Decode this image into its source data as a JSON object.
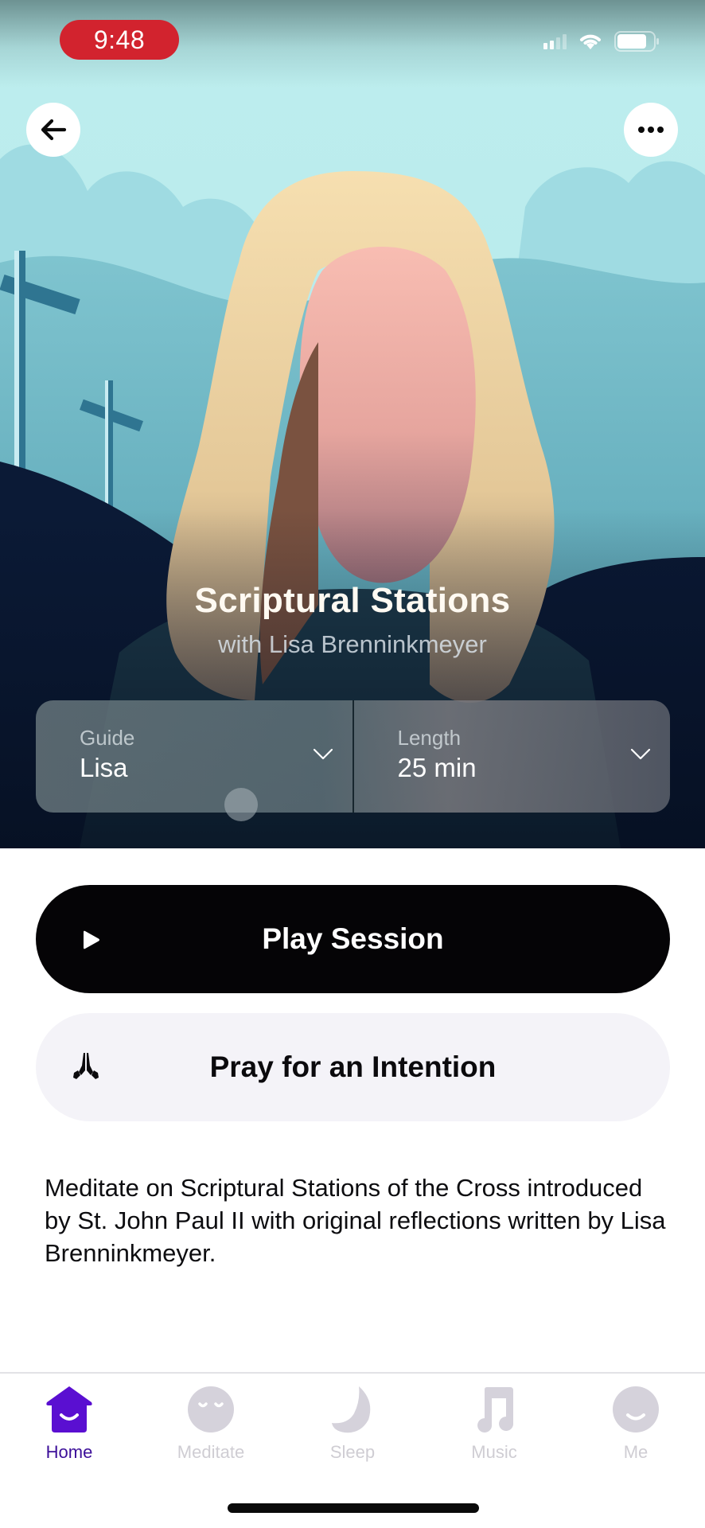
{
  "status_bar": {
    "time": "9:48",
    "icons": [
      "cellular-signal-icon",
      "wifi-icon",
      "battery-icon"
    ]
  },
  "header": {
    "back_icon": "arrow-left-icon",
    "more_icon": "ellipsis-horizontal-icon"
  },
  "session": {
    "title": "Scriptural Stations",
    "subtitle": "with Lisa Brenninkmeyer",
    "description": "Meditate on Scriptural Stations of the Cross introduced by St. John Paul II with original reflections written by Lisa Brenninkmeyer."
  },
  "selectors": [
    {
      "label": "Guide",
      "value": "Lisa",
      "icon": "chevron-down-icon"
    },
    {
      "label": "Length",
      "value": "25 min",
      "icon": "chevron-down-icon"
    }
  ],
  "actions": {
    "play": {
      "label": "Play Session",
      "icon": "play-icon"
    },
    "pray": {
      "label": "Pray for an Intention",
      "icon": "praying-hands-icon"
    }
  },
  "tabbar": {
    "active": "Home",
    "items": [
      {
        "label": "Home",
        "icon": "home-smile-icon"
      },
      {
        "label": "Meditate",
        "icon": "meditate-face-icon"
      },
      {
        "label": "Sleep",
        "icon": "moon-icon"
      },
      {
        "label": "Music",
        "icon": "music-note-icon"
      },
      {
        "label": "Me",
        "icon": "profile-smile-icon"
      }
    ]
  },
  "colors": {
    "accent": "#5a0fd1",
    "active_tab_label": "#3c0f99",
    "inactive_tab": "#d3d0da",
    "time_pill": "#d2232e",
    "play_button": "#050406",
    "pray_button": "#f4f3f8"
  }
}
